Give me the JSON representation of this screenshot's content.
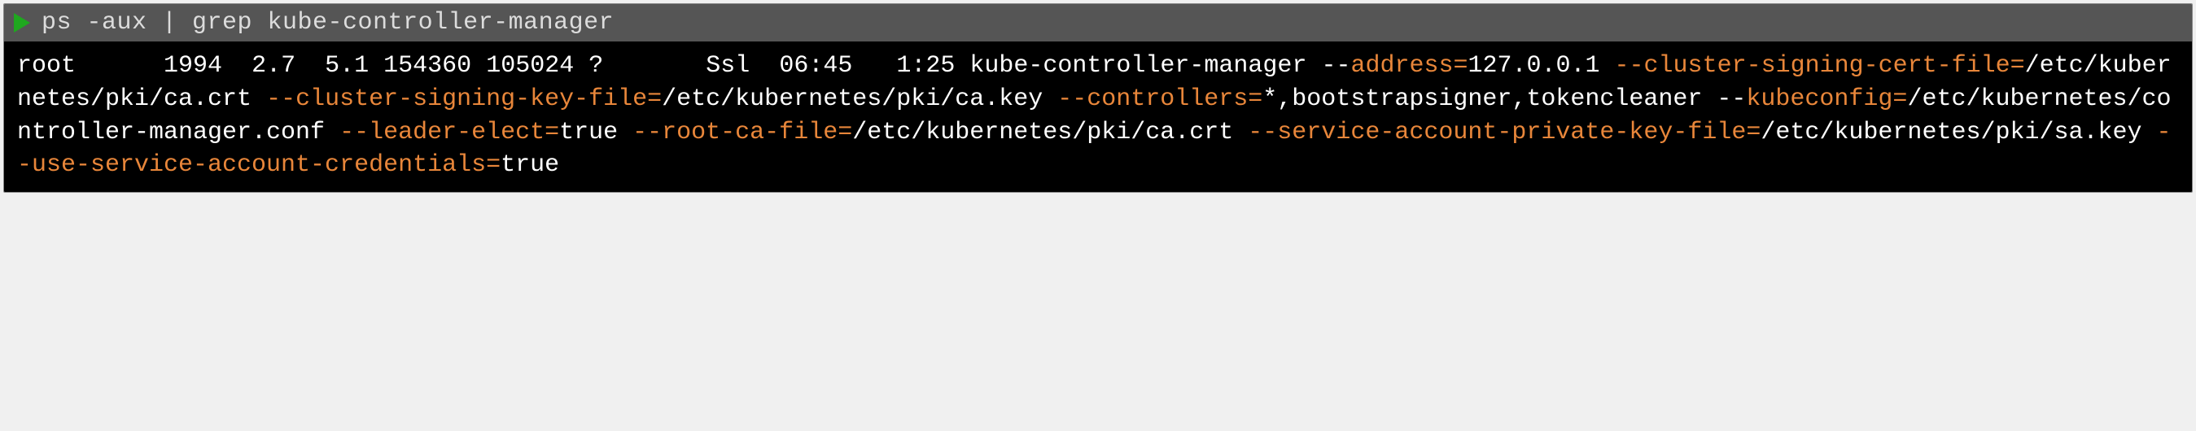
{
  "command": "ps -aux | grep kube-controller-manager",
  "ps": {
    "user": "root",
    "pid": "1994",
    "cpu": "2.7",
    "mem": "5.1",
    "vsz": "154360",
    "rss": "105024",
    "tty": "?",
    "stat": "Ssl",
    "start": "06:45",
    "time": "1:25",
    "cmd": "kube-controller-manager"
  },
  "flags": {
    "address_key": "address=",
    "address_val": "127.0.0.1",
    "cluster_signing_cert_key": "--cluster-signing-cert-file=",
    "cluster_signing_cert_val": "/etc/kubernetes/pki/ca.crt",
    "cluster_signing_key_key": "--cluster-signing-key-file=",
    "cluster_signing_key_val": "/etc/kubernetes/pki/ca.key",
    "controllers_key": "--controllers=",
    "controllers_val": "*,bootstrapsigner,tokencleaner",
    "kubeconfig_key": "kubeconfig=",
    "kubeconfig_val": "/etc/kubernetes/controller-manager.conf",
    "leader_elect_key": "--leader-elect=",
    "leader_elect_val": "true",
    "root_ca_key": "--root-ca-file=",
    "root_ca_val": "/etc/kubernetes/pki/ca.crt",
    "sa_priv_key_key": "--service-account-private-key-file=",
    "sa_priv_key_val": "/etc/kubernetes/pki/sa.key",
    "use_sa_creds_key": "--use-service-account-credentials=",
    "use_sa_creds_val": "true"
  },
  "sep": {
    "dashdash": " --",
    "space": " ",
    "dashdash_nl": "--"
  }
}
